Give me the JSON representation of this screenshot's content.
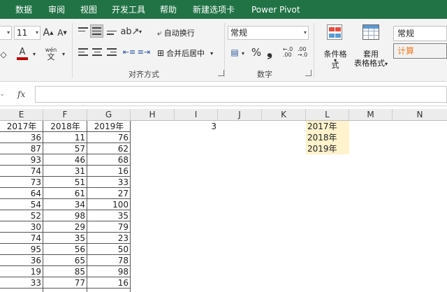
{
  "tabs": [
    "数据",
    "审阅",
    "视图",
    "开发工具",
    "帮助",
    "新建选项卡",
    "Power Pivot"
  ],
  "font": {
    "size": "11",
    "grow_label": "A",
    "shrink_label": "A",
    "color_label": "A",
    "phonetic_label": "wén"
  },
  "alignment": {
    "wrap_label": "自动换行",
    "merge_label": "合并后居中",
    "group_label": "对齐方式"
  },
  "number": {
    "format_value": "常规",
    "percent_label": "%",
    "comma_label": "❟",
    "group_label": "数字"
  },
  "styles": {
    "conditional_label": "条件格式",
    "table_label_1": "套用",
    "table_label_2": "表格格式",
    "normal_style": "常规",
    "calc_style": "计算"
  },
  "formula_bar": {
    "fx_label": "fx",
    "value": ""
  },
  "columns": [
    "E",
    "F",
    "G",
    "H",
    "I",
    "J",
    "K",
    "L",
    "M",
    "N"
  ],
  "table": {
    "headers": [
      "2017年",
      "2018年",
      "2019年"
    ],
    "rows": [
      [
        "36",
        "11",
        "76"
      ],
      [
        "87",
        "57",
        "62"
      ],
      [
        "93",
        "46",
        "68"
      ],
      [
        "74",
        "31",
        "16"
      ],
      [
        "73",
        "51",
        "33"
      ],
      [
        "64",
        "61",
        "27"
      ],
      [
        "54",
        "34",
        "100"
      ],
      [
        "52",
        "98",
        "35"
      ],
      [
        "30",
        "29",
        "79"
      ],
      [
        "74",
        "35",
        "23"
      ],
      [
        "95",
        "56",
        "50"
      ],
      [
        "36",
        "65",
        "78"
      ],
      [
        "19",
        "85",
        "98"
      ],
      [
        "33",
        "77",
        "16"
      ]
    ]
  },
  "i_cell": "3",
  "l_list": [
    "2017年",
    "2018年",
    "2019年"
  ],
  "colors": {
    "brand": "#217346",
    "highlight": "#fff2cc",
    "font_red": "#c00000",
    "calc_orange": "#f47b20"
  }
}
